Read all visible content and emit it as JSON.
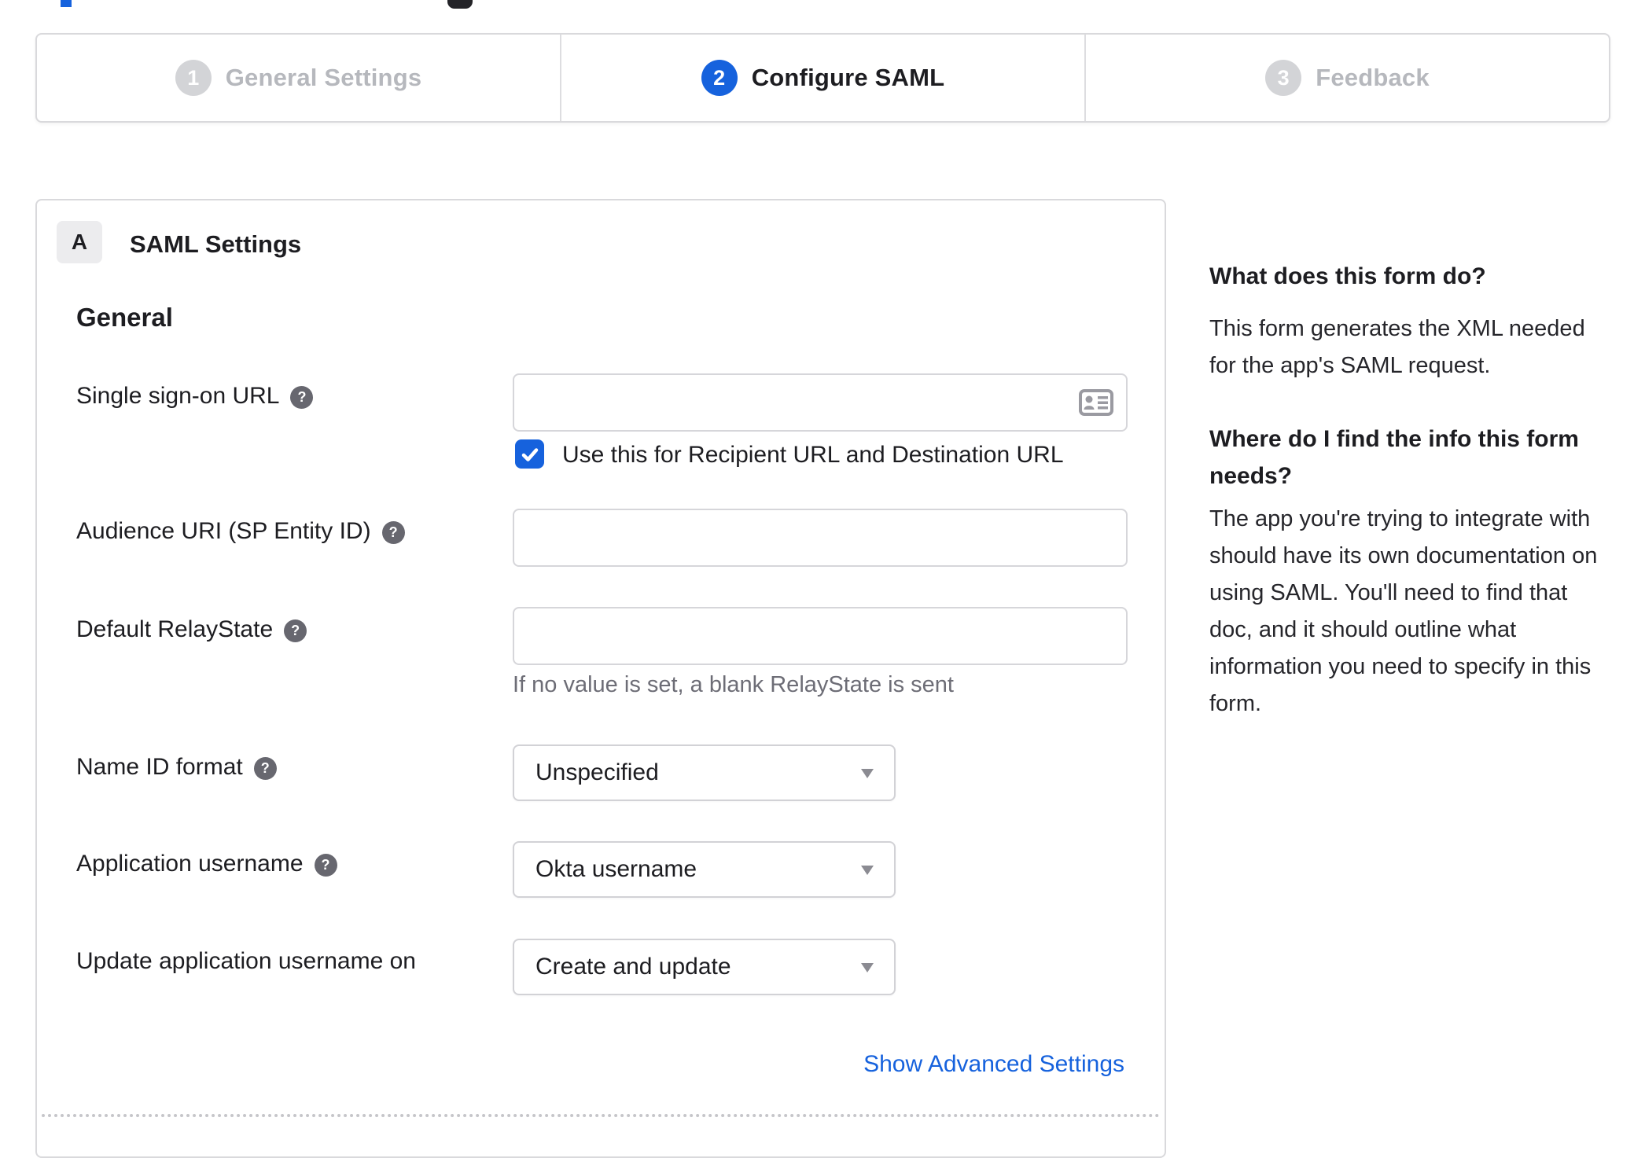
{
  "accent_color": "#1662dd",
  "icons": {
    "help": "?"
  },
  "stepper": {
    "active_step": 2,
    "steps": [
      {
        "number": "1",
        "label": "General Settings"
      },
      {
        "number": "2",
        "label": "Configure SAML"
      },
      {
        "number": "3",
        "label": "Feedback"
      }
    ]
  },
  "panel": {
    "badge": "A",
    "title": "SAML Settings",
    "section_heading": "General",
    "rows": [
      {
        "label": "Single sign-on URL",
        "help": true,
        "control": "text-input",
        "value": "",
        "checkbox_label": "Use this for Recipient URL and Destination URL",
        "checkbox_checked": true
      },
      {
        "label": "Audience URI (SP Entity ID)",
        "help": true,
        "control": "text-input",
        "value": ""
      },
      {
        "label": "Default RelayState",
        "help": true,
        "control": "text-input",
        "value": "",
        "helper_text": "If no value is set, a blank RelayState is sent"
      },
      {
        "label": "Name ID format",
        "help": true,
        "control": "select",
        "value": "Unspecified"
      },
      {
        "label": "Application username",
        "help": true,
        "control": "select",
        "value": "Okta username"
      },
      {
        "label": "Update application username on",
        "help": false,
        "control": "select",
        "value": "Create and update"
      }
    ],
    "advanced_link": "Show Advanced Settings"
  },
  "sidebar": {
    "sections": [
      {
        "heading": "What does this form do?",
        "body": "This form generates the XML needed for the app's SAML request."
      },
      {
        "heading": "Where do I find the info this form needs?",
        "body": "The app you're trying to integrate with should have its own documentation on using SAML. You'll need to find that doc, and it should outline what information you need to specify in this form."
      }
    ]
  }
}
